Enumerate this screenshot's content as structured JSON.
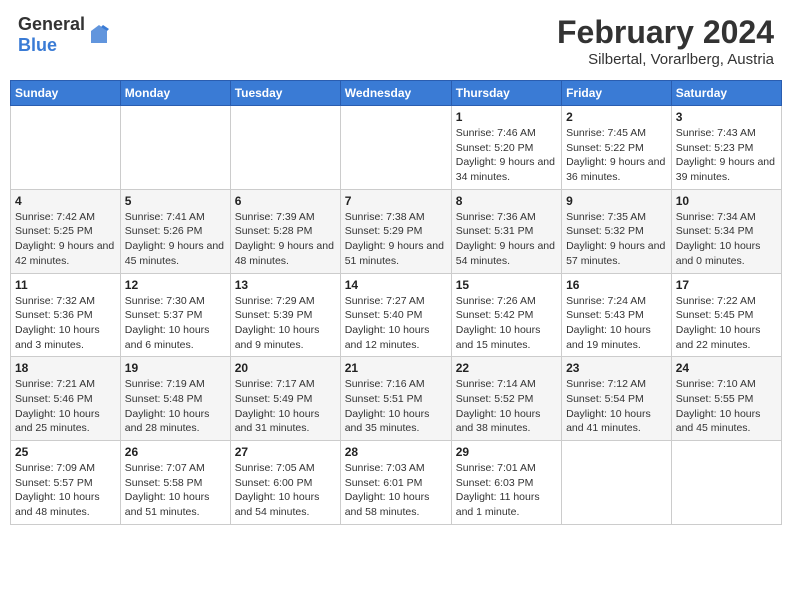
{
  "header": {
    "logo_general": "General",
    "logo_blue": "Blue",
    "month_title": "February 2024",
    "location": "Silbertal, Vorarlberg, Austria"
  },
  "days_of_week": [
    "Sunday",
    "Monday",
    "Tuesday",
    "Wednesday",
    "Thursday",
    "Friday",
    "Saturday"
  ],
  "weeks": [
    [
      {
        "day": "",
        "info": ""
      },
      {
        "day": "",
        "info": ""
      },
      {
        "day": "",
        "info": ""
      },
      {
        "day": "",
        "info": ""
      },
      {
        "day": "1",
        "info": "Sunrise: 7:46 AM\nSunset: 5:20 PM\nDaylight: 9 hours and 34 minutes."
      },
      {
        "day": "2",
        "info": "Sunrise: 7:45 AM\nSunset: 5:22 PM\nDaylight: 9 hours and 36 minutes."
      },
      {
        "day": "3",
        "info": "Sunrise: 7:43 AM\nSunset: 5:23 PM\nDaylight: 9 hours and 39 minutes."
      }
    ],
    [
      {
        "day": "4",
        "info": "Sunrise: 7:42 AM\nSunset: 5:25 PM\nDaylight: 9 hours and 42 minutes."
      },
      {
        "day": "5",
        "info": "Sunrise: 7:41 AM\nSunset: 5:26 PM\nDaylight: 9 hours and 45 minutes."
      },
      {
        "day": "6",
        "info": "Sunrise: 7:39 AM\nSunset: 5:28 PM\nDaylight: 9 hours and 48 minutes."
      },
      {
        "day": "7",
        "info": "Sunrise: 7:38 AM\nSunset: 5:29 PM\nDaylight: 9 hours and 51 minutes."
      },
      {
        "day": "8",
        "info": "Sunrise: 7:36 AM\nSunset: 5:31 PM\nDaylight: 9 hours and 54 minutes."
      },
      {
        "day": "9",
        "info": "Sunrise: 7:35 AM\nSunset: 5:32 PM\nDaylight: 9 hours and 57 minutes."
      },
      {
        "day": "10",
        "info": "Sunrise: 7:34 AM\nSunset: 5:34 PM\nDaylight: 10 hours and 0 minutes."
      }
    ],
    [
      {
        "day": "11",
        "info": "Sunrise: 7:32 AM\nSunset: 5:36 PM\nDaylight: 10 hours and 3 minutes."
      },
      {
        "day": "12",
        "info": "Sunrise: 7:30 AM\nSunset: 5:37 PM\nDaylight: 10 hours and 6 minutes."
      },
      {
        "day": "13",
        "info": "Sunrise: 7:29 AM\nSunset: 5:39 PM\nDaylight: 10 hours and 9 minutes."
      },
      {
        "day": "14",
        "info": "Sunrise: 7:27 AM\nSunset: 5:40 PM\nDaylight: 10 hours and 12 minutes."
      },
      {
        "day": "15",
        "info": "Sunrise: 7:26 AM\nSunset: 5:42 PM\nDaylight: 10 hours and 15 minutes."
      },
      {
        "day": "16",
        "info": "Sunrise: 7:24 AM\nSunset: 5:43 PM\nDaylight: 10 hours and 19 minutes."
      },
      {
        "day": "17",
        "info": "Sunrise: 7:22 AM\nSunset: 5:45 PM\nDaylight: 10 hours and 22 minutes."
      }
    ],
    [
      {
        "day": "18",
        "info": "Sunrise: 7:21 AM\nSunset: 5:46 PM\nDaylight: 10 hours and 25 minutes."
      },
      {
        "day": "19",
        "info": "Sunrise: 7:19 AM\nSunset: 5:48 PM\nDaylight: 10 hours and 28 minutes."
      },
      {
        "day": "20",
        "info": "Sunrise: 7:17 AM\nSunset: 5:49 PM\nDaylight: 10 hours and 31 minutes."
      },
      {
        "day": "21",
        "info": "Sunrise: 7:16 AM\nSunset: 5:51 PM\nDaylight: 10 hours and 35 minutes."
      },
      {
        "day": "22",
        "info": "Sunrise: 7:14 AM\nSunset: 5:52 PM\nDaylight: 10 hours and 38 minutes."
      },
      {
        "day": "23",
        "info": "Sunrise: 7:12 AM\nSunset: 5:54 PM\nDaylight: 10 hours and 41 minutes."
      },
      {
        "day": "24",
        "info": "Sunrise: 7:10 AM\nSunset: 5:55 PM\nDaylight: 10 hours and 45 minutes."
      }
    ],
    [
      {
        "day": "25",
        "info": "Sunrise: 7:09 AM\nSunset: 5:57 PM\nDaylight: 10 hours and 48 minutes."
      },
      {
        "day": "26",
        "info": "Sunrise: 7:07 AM\nSunset: 5:58 PM\nDaylight: 10 hours and 51 minutes."
      },
      {
        "day": "27",
        "info": "Sunrise: 7:05 AM\nSunset: 6:00 PM\nDaylight: 10 hours and 54 minutes."
      },
      {
        "day": "28",
        "info": "Sunrise: 7:03 AM\nSunset: 6:01 PM\nDaylight: 10 hours and 58 minutes."
      },
      {
        "day": "29",
        "info": "Sunrise: 7:01 AM\nSunset: 6:03 PM\nDaylight: 11 hours and 1 minute."
      },
      {
        "day": "",
        "info": ""
      },
      {
        "day": "",
        "info": ""
      }
    ]
  ]
}
